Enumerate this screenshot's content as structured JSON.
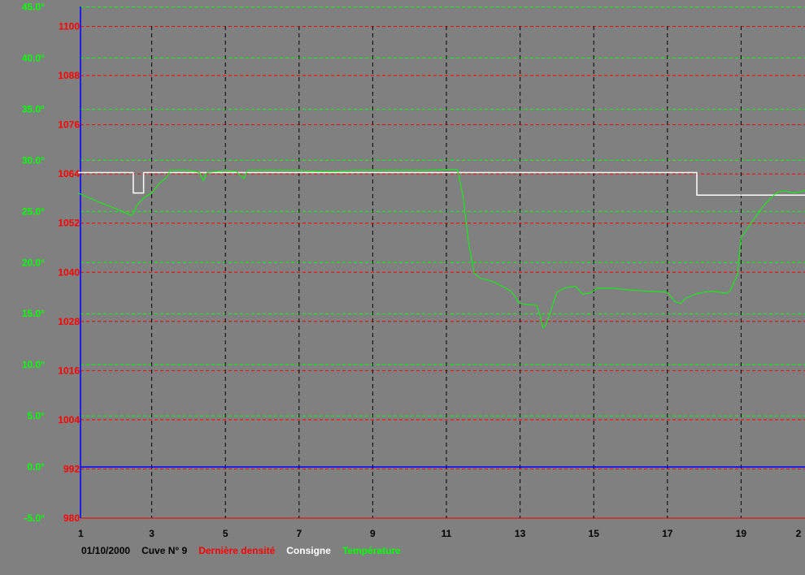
{
  "chart_data": {
    "type": "line",
    "x_ticks": [
      "1",
      "3",
      "5",
      "7",
      "9",
      "11",
      "13",
      "15",
      "17",
      "19",
      "2"
    ],
    "xlim": [
      1,
      21
    ],
    "temperature_axis": {
      "ticks": [
        "45.0°",
        "40.0°",
        "35.0°",
        "30.0°",
        "25.0°",
        "20.0°",
        "15.0°",
        "10.0°",
        "5.0°",
        "0.0°",
        "-5.0°"
      ],
      "ylim": [
        -5,
        45
      ],
      "color": "#00ff00"
    },
    "density_axis": {
      "ticks": [
        "1100",
        "1088",
        "1076",
        "1064",
        "1052",
        "1040",
        "1028",
        "1016",
        "1004",
        "992",
        "980"
      ],
      "ylim": [
        980,
        1100
      ],
      "color": "#ff0000"
    },
    "series": [
      {
        "name": "Consigne",
        "color": "#ffffff",
        "axis": "temperature",
        "points": [
          [
            1,
            28.8
          ],
          [
            2.5,
            28.8
          ],
          [
            2.5,
            26.8
          ],
          [
            2.78,
            26.8
          ],
          [
            2.78,
            28.8
          ],
          [
            12.2,
            28.8
          ],
          [
            12.35,
            28.8
          ],
          [
            12.7,
            28.8
          ],
          [
            17.8,
            28.8
          ],
          [
            17.8,
            26.6
          ],
          [
            19.7,
            26.6
          ],
          [
            20.3,
            26.6
          ],
          [
            21,
            26.6
          ]
        ]
      },
      {
        "name": "Température",
        "color": "#00ff00",
        "axis": "temperature",
        "points": [
          [
            1,
            26.8
          ],
          [
            1.5,
            26.0
          ],
          [
            2.0,
            25.3
          ],
          [
            2.45,
            24.6
          ],
          [
            2.5,
            24.8
          ],
          [
            2.6,
            25.6
          ],
          [
            2.78,
            26.3
          ],
          [
            3.0,
            26.8
          ],
          [
            3.2,
            27.7
          ],
          [
            3.4,
            28.3
          ],
          [
            3.5,
            29.0
          ],
          [
            4.0,
            29.0
          ],
          [
            4.3,
            28.8
          ],
          [
            4.4,
            28.0
          ],
          [
            4.5,
            28.8
          ],
          [
            5.0,
            29.0
          ],
          [
            5.3,
            28.9
          ],
          [
            5.5,
            28.2
          ],
          [
            5.6,
            29.0
          ],
          [
            6.0,
            29.0
          ],
          [
            7.0,
            29.0
          ],
          [
            7.5,
            28.9
          ],
          [
            8.0,
            28.9
          ],
          [
            8.5,
            29.0
          ],
          [
            9.0,
            29.0
          ],
          [
            9.5,
            29.0
          ],
          [
            10.0,
            29.0
          ],
          [
            10.5,
            29.0
          ],
          [
            11.0,
            29.1
          ],
          [
            11.3,
            29.1
          ],
          [
            11.45,
            26.5
          ],
          [
            11.6,
            22.0
          ],
          [
            11.75,
            19.0
          ],
          [
            11.9,
            18.5
          ],
          [
            12.1,
            18.3
          ],
          [
            12.3,
            18.1
          ],
          [
            12.5,
            17.7
          ],
          [
            12.75,
            17.2
          ],
          [
            12.88,
            16.6
          ],
          [
            12.95,
            16.1
          ],
          [
            13.0,
            16.0
          ],
          [
            13.2,
            15.9
          ],
          [
            13.45,
            15.8
          ],
          [
            13.55,
            14.7
          ],
          [
            13.62,
            13.6
          ],
          [
            13.7,
            13.9
          ],
          [
            13.8,
            14.9
          ],
          [
            14.0,
            17.1
          ],
          [
            14.2,
            17.5
          ],
          [
            14.5,
            17.7
          ],
          [
            14.7,
            16.9
          ],
          [
            14.9,
            17.0
          ],
          [
            15.1,
            17.5
          ],
          [
            15.5,
            17.5
          ],
          [
            16.0,
            17.3
          ],
          [
            16.5,
            17.2
          ],
          [
            17.0,
            17.1
          ],
          [
            17.2,
            16.2
          ],
          [
            17.35,
            16.0
          ],
          [
            17.5,
            16.5
          ],
          [
            17.75,
            16.9
          ],
          [
            18.0,
            17.1
          ],
          [
            18.2,
            17.2
          ],
          [
            18.4,
            17.1
          ],
          [
            18.6,
            17.0
          ],
          [
            18.7,
            17.2
          ],
          [
            18.9,
            18.8
          ],
          [
            19.0,
            22.4
          ],
          [
            19.3,
            24.0
          ],
          [
            19.6,
            25.5
          ],
          [
            19.8,
            26.3
          ],
          [
            20.0,
            26.9
          ],
          [
            20.2,
            27.0
          ],
          [
            20.4,
            26.8
          ],
          [
            20.6,
            26.9
          ],
          [
            20.75,
            27.1
          ],
          [
            20.8,
            26.5
          ],
          [
            20.82,
            21.6
          ],
          [
            20.84,
            23.8
          ],
          [
            20.9,
            26.9
          ],
          [
            21.0,
            27.0
          ]
        ]
      }
    ],
    "grid": true
  },
  "legend": {
    "date": "01/10/2000",
    "cuve": "Cuve N° 9",
    "derniere_densite": "Dernière densité",
    "consigne": "Consigne",
    "temperature": "Température"
  },
  "colors": {
    "background": "#808080",
    "axis": "#0000ff",
    "density_grid": "#ff0000",
    "temperature_grid": "#00ff00",
    "x_grid": "#000000"
  }
}
